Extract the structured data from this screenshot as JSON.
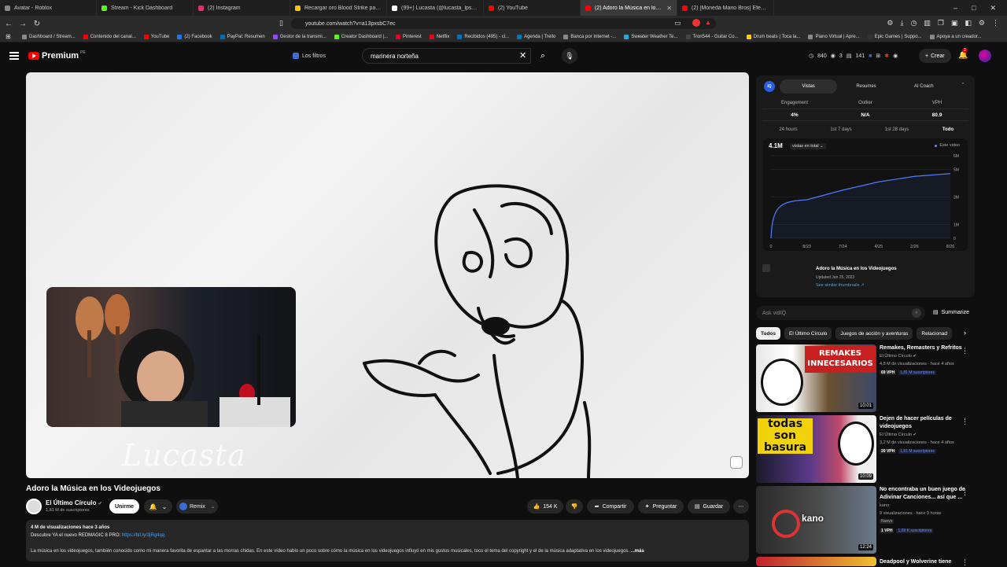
{
  "browser": {
    "tabs": [
      {
        "label": "Avatar - Roblox",
        "color": "#888888",
        "active": false
      },
      {
        "label": "Stream - Kick Dashboard",
        "color": "#53fc18",
        "active": false
      },
      {
        "label": "(2) Instagram",
        "color": "#e1306c",
        "active": false
      },
      {
        "label": "Recargar oro Blood Strike pagos fácil",
        "color": "#f5c400",
        "active": false
      },
      {
        "label": "(99+) Lucasta (@lucasta_lps) | TikTok",
        "color": "#ffffff",
        "active": false
      },
      {
        "label": "(2) YouTube",
        "color": "#ff0000",
        "active": false
      },
      {
        "label": "(2) Adoro la Música en los V",
        "color": "#ff0000",
        "active": true
      },
      {
        "label": "(2) [Moneda Mario Bros] Efecto de S",
        "color": "#ff0000",
        "active": false
      }
    ],
    "window_controls": [
      "–",
      "□",
      "✕"
    ],
    "url": "youtube.com/watch?v=a13pxsbC7ec",
    "bookmarks": [
      "Dashboard / Stream...",
      "Contenido del canal...",
      "YouTube",
      "(2) Facebook",
      "PayPal: Resumen",
      "Gestor de la transmi...",
      "Creator Dashboard |...",
      "Pinterest",
      "Netflix",
      "Recibidos (495) - cl...",
      "Agenda | Trello",
      "Banca por Internet -...",
      "Sweater Weather Te...",
      "Tron544 - Guitar Co...",
      "Drum beats | Toca la...",
      "Piano Virtual | Apre...",
      "Epic Games | Suppo...",
      "Apoya a un creador..."
    ]
  },
  "youtube": {
    "brand": "Premium",
    "region": "PE",
    "filters_label": "Los filtros",
    "search_value": "marinera norteña",
    "header_stats": [
      "840",
      "3",
      "141"
    ],
    "create_label": "Crear",
    "notif_count": "2"
  },
  "video": {
    "watermark": "Lucasta",
    "title": "Adoro la Música en los Videojuegos",
    "channel": "El Último Círculo",
    "subs": "1,81 M de suscriptores",
    "join": "Unirme",
    "remix": "Remix",
    "likes": "154 K",
    "share": "Compartir",
    "ask": "Preguntar",
    "save": "Guardar",
    "desc_stats": "4 M de visualizaciones  hace 3 años",
    "desc_promo": "Descubre YA el nuevo REDMAGIC 8 PRO: ",
    "desc_link": "https://bit.ly/3jRg4qq",
    "desc_body": "La música en los videojuegos, también conocido como mi manera favorita de espantar a las morras chidas. En este vídeo hablo un poco sobre cómo la música en los videojuegos influyó en mis gustos musicales, toco el tema del copyright y el de la música adaptativa en los videojuegos.",
    "desc_more": "...más"
  },
  "vidiq": {
    "logo": "IQ",
    "tabs": [
      "Vistas",
      "Resumes",
      "AI Coach"
    ],
    "metrics": [
      {
        "label": "Engagement",
        "value": "4%"
      },
      {
        "label": "Outlier",
        "value": "N/A"
      },
      {
        "label": "VPH",
        "value": "80.9"
      }
    ],
    "ranges": [
      "24 hours",
      "1st 7 days",
      "1st 28 days",
      "Todo"
    ],
    "active_range": "Todo",
    "total_views": "4.1M",
    "views_dropdown": "vistas en total",
    "legend": "Este video",
    "video_title": "Adoro la Música en los Videojuegos",
    "updated": "Updated Jan 25, 2023",
    "similar": "See similar thumbnails ↗",
    "ask_placeholder": "Ask vidIQ",
    "summarize": "Summarize"
  },
  "chart_data": {
    "type": "line",
    "x": [
      "0",
      "8/23",
      "7/24",
      "4/25",
      "2/26",
      "8/26"
    ],
    "y_ticks": [
      "0",
      "1M",
      "3M",
      "5M",
      "6M"
    ],
    "ylim": [
      0,
      6
    ],
    "series": [
      {
        "name": "Este video",
        "values": [
          0,
          2.8,
          3.5,
          4.1,
          4.5,
          4.7
        ]
      }
    ]
  },
  "chips": [
    "Todos",
    "El Último Círculo",
    "Juegos de acción y aventuras",
    "Relacionad"
  ],
  "recommendations": [
    {
      "title": "Remakes, Remasters y Refritos",
      "channel": "El Último Círculo",
      "meta": "4,8 M de visualizaciones · hace 4 años",
      "vph": "69 VPH",
      "subs": "1,81 M suscriptores",
      "duration": "10:01",
      "thumb_text": "REMAKES INNECESARIOS",
      "new": ""
    },
    {
      "title": "Dejen de hacer películas de videojuegos",
      "channel": "El Último Círculo",
      "meta": "3,2 M de visualizaciones · hace 4 años",
      "vph": "20 VPH",
      "subs": "1,81 M suscriptores",
      "duration": "10:09",
      "thumb_text": "todas son basura",
      "new": ""
    },
    {
      "title": "No encontraba un buen juego de Adivinar Canciones... así que ...",
      "channel": "kano",
      "meta": "9 visualizaciones · hace 9 horas",
      "vph": "1 VPH",
      "subs": "1,09 K suscriptores",
      "duration": "12:24",
      "thumb_text": "kano",
      "new": "Nuevo"
    },
    {
      "title": "Deadpool y Wolverine tiene",
      "channel": "",
      "meta": "",
      "vph": "",
      "subs": "",
      "duration": "",
      "thumb_text": "",
      "new": ""
    }
  ]
}
